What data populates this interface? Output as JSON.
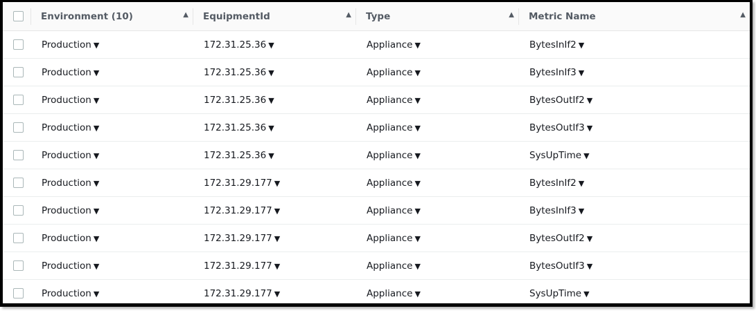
{
  "columns": [
    {
      "label": "Environment (10)",
      "sort_icon": "sort-asc-icon"
    },
    {
      "label": "EquipmentId",
      "sort_icon": "sort-asc-icon"
    },
    {
      "label": "Type",
      "sort_icon": "sort-asc-icon"
    },
    {
      "label": "Metric Name",
      "sort_icon": "sort-asc-icon"
    }
  ],
  "rows": [
    [
      "Production",
      "172.31.25.36",
      "Appliance",
      "BytesInIf2"
    ],
    [
      "Production",
      "172.31.25.36",
      "Appliance",
      "BytesInIf3"
    ],
    [
      "Production",
      "172.31.25.36",
      "Appliance",
      "BytesOutIf2"
    ],
    [
      "Production",
      "172.31.25.36",
      "Appliance",
      "BytesOutIf3"
    ],
    [
      "Production",
      "172.31.25.36",
      "Appliance",
      "SysUpTime"
    ],
    [
      "Production",
      "172.31.29.177",
      "Appliance",
      "BytesInIf2"
    ],
    [
      "Production",
      "172.31.29.177",
      "Appliance",
      "BytesInIf3"
    ],
    [
      "Production",
      "172.31.29.177",
      "Appliance",
      "BytesOutIf2"
    ],
    [
      "Production",
      "172.31.29.177",
      "Appliance",
      "BytesOutIf3"
    ],
    [
      "Production",
      "172.31.29.177",
      "Appliance",
      "SysUpTime"
    ]
  ],
  "icons": {
    "sort": "▲",
    "filter": "▼"
  }
}
